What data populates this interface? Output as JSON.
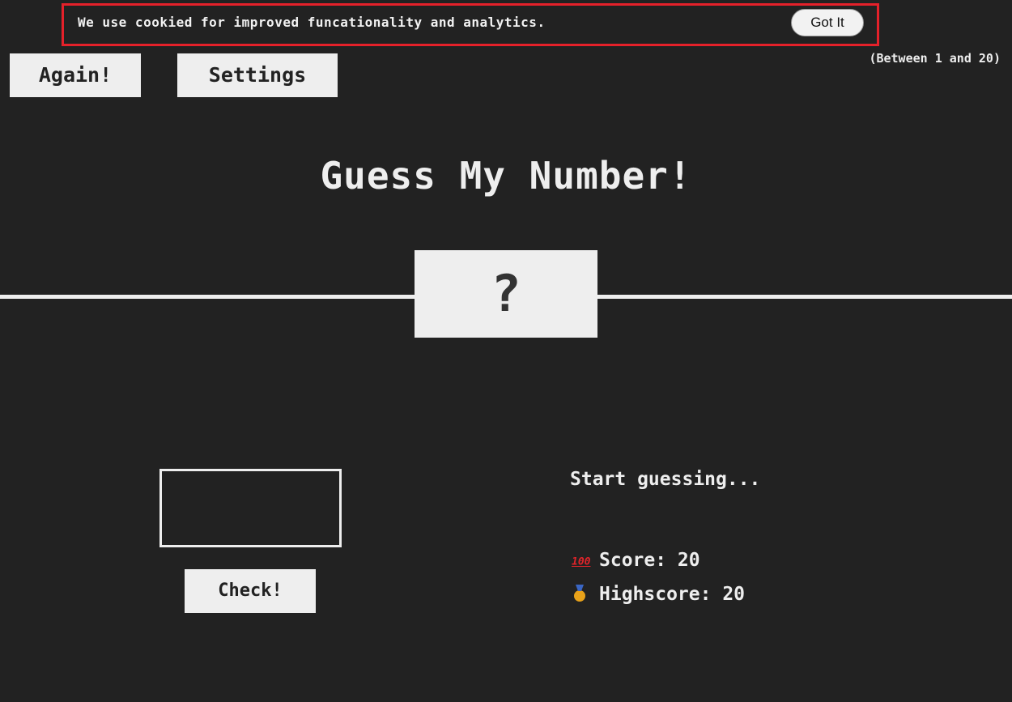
{
  "cookie": {
    "text": "We use cookied for improved funcationality and analytics.",
    "button": "Got It"
  },
  "toolbar": {
    "again_label": "Again!",
    "settings_label": "Settings"
  },
  "range_hint": "(Between 1 and 20)",
  "title": "Guess My Number!",
  "secret_number": "?",
  "guess": {
    "value": ""
  },
  "check_label": "Check!",
  "message": "Start guessing...",
  "score": {
    "icon": "hundred-points-icon",
    "label": "Score: 20"
  },
  "highscore": {
    "icon": "medal-icon",
    "label": "Highscore: 20"
  },
  "colors": {
    "background": "#222222",
    "foreground": "#eeeeee",
    "highlight_border": "#e5212a"
  }
}
